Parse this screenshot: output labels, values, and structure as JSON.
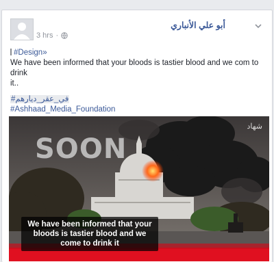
{
  "post": {
    "author": "أبو علي الأنباري",
    "time": "3 hrs",
    "time_sep": "·",
    "line1_tag": "#Design»",
    "line2": "We have been informed that your bloods is tastier blood and we com to drink",
    "line3": "it..",
    "tag_arabic": "#في_عقر_ديارهم",
    "tag_foundation": "#Ashhaad_Media_Foundation",
    "icons": {
      "menu": "chevron-down-icon",
      "privacy": "globe-icon"
    }
  },
  "image": {
    "overlay_text": "We have been informed that your bloods is tastier blood and we come to drink it",
    "soon_text": "SOON",
    "watermark": "شهاد",
    "colors": {
      "smoke": "#1a1a1a",
      "fire": "#ff6a1a",
      "blood": "#e01020"
    }
  }
}
